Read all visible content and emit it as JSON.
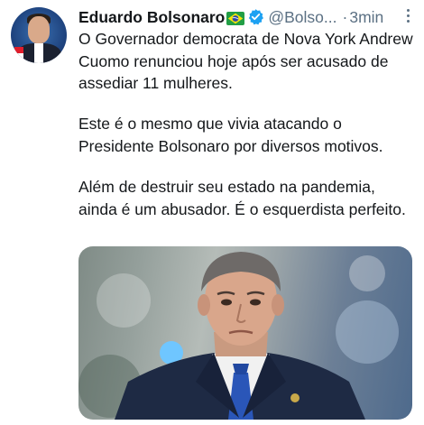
{
  "tweet": {
    "author": {
      "name": "Eduardo Bolsonaro",
      "handle": "@Bolso...",
      "separator": "·",
      "time": "3min"
    },
    "paragraphs": [
      "O Governador democrata de Nova York Andrew Cuomo renunciou hoje após ser acusado de assediar 11 mulheres.",
      "Este é o mesmo que vivia atacando o Presidente Bolsonaro por diversos motivos.",
      "Além de destruir seu estado na pandemia, ainda é um abusador. É o esquerdista perfeito."
    ]
  },
  "icons": [
    "avatar",
    "brazil-flag-icon",
    "verified-badge-icon",
    "more-options-icon"
  ],
  "colors": {
    "text": "#14171a",
    "secondary": "#5b7083",
    "verified": "#1da1f2"
  }
}
